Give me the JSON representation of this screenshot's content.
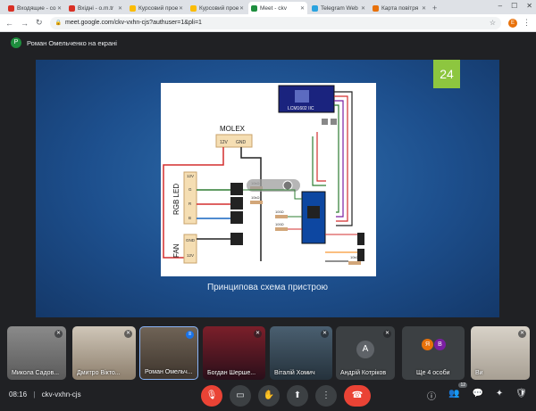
{
  "browser": {
    "tabs": [
      {
        "title": "Входящие - co",
        "color": "#d93025",
        "active": false
      },
      {
        "title": "Вхідні - o.m.tr",
        "color": "#d93025",
        "active": false
      },
      {
        "title": "Курсовий прое",
        "color": "#fbbc04",
        "active": false
      },
      {
        "title": "Курсовий прое",
        "color": "#fbbc04",
        "active": false
      },
      {
        "title": "Meet - ckv",
        "color": "#1e8e3e",
        "active": true
      },
      {
        "title": "Telegram Web",
        "color": "#2aa3df",
        "active": false
      },
      {
        "title": "Карта повітря",
        "color": "#e8710a",
        "active": false
      }
    ],
    "new_tab": "+",
    "url": "meet.google.com/ckv-vxhn-cjs?authuser=1&pli=1",
    "profile_initial": "E"
  },
  "meet": {
    "presenter_initial": "Р",
    "presenter_label": "Роман Омельченко на екрані",
    "slide": {
      "number": "24",
      "caption": "Принципова схема пристрою",
      "labels": {
        "lcm": "LCM1602 IIC",
        "molex": "MOLEX",
        "v12": "12V",
        "gnd": "GND",
        "rgb": "RGB LED",
        "fan": "FAN",
        "g": "G",
        "r": "R",
        "b": "B",
        "r10k": "10kΩ",
        "r100": "100Ω"
      }
    },
    "participants": [
      {
        "name": "Микола Садов...",
        "muted": true
      },
      {
        "name": "Дмитро Вікто...",
        "muted": true
      },
      {
        "name": "Роман Омельч...",
        "muted": false
      },
      {
        "name": "Богдан Шерше...",
        "muted": true
      },
      {
        "name": "Віталій Хомич",
        "muted": true
      },
      {
        "name": "Андрій Котріков",
        "initial": "А",
        "muted": true
      },
      {
        "name": "Ще 4 особи",
        "initials": [
          "Я",
          "В"
        ]
      },
      {
        "name": "Ви",
        "muted": true
      }
    ],
    "time": "08:16",
    "separator": "|",
    "meeting_code": "ckv-vxhn-cjs",
    "people_count": "12"
  }
}
